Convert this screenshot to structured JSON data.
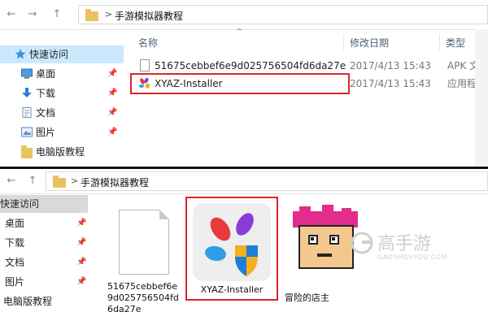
{
  "top_window": {
    "breadcrumb": {
      "sep": ">",
      "folder": "手游模拟器教程"
    },
    "nav": {
      "back": "←",
      "forward": "→",
      "up": "↑"
    },
    "columns": {
      "name": "名称",
      "date": "修改日期",
      "type": "类型"
    },
    "sidebar": [
      {
        "label": "快速访问",
        "icon": "star-icon"
      },
      {
        "label": "桌面",
        "icon": "desktop-icon",
        "pin": "📌"
      },
      {
        "label": "下载",
        "icon": "download-icon",
        "pin": "📌"
      },
      {
        "label": "文档",
        "icon": "document-icon",
        "pin": "📌"
      },
      {
        "label": "图片",
        "icon": "picture-icon",
        "pin": "📌"
      },
      {
        "label": "电脑版教程",
        "icon": "folder-icon"
      }
    ],
    "files": [
      {
        "name": "51675cebbef6e9d025756504fd6da27e",
        "date": "2017/4/13 15:43",
        "type": "APK 文件"
      },
      {
        "name": "XYAZ-Installer",
        "date": "2017/4/13 15:43",
        "type": "应用程序"
      }
    ]
  },
  "bottom_window": {
    "breadcrumb": {
      "sep": ">",
      "folder": "手游模拟器教程"
    },
    "sidebar": [
      {
        "label": "快速访问"
      },
      {
        "label": "桌面",
        "pin": "📌"
      },
      {
        "label": "下载",
        "pin": "📌"
      },
      {
        "label": "文档",
        "pin": "📌"
      },
      {
        "label": "图片",
        "pin": "📌"
      },
      {
        "label": "电脑版教程"
      }
    ],
    "icons": [
      {
        "label": "51675cebbef6e9d025756504fd6da27e"
      },
      {
        "label": "XYAZ-Installer"
      },
      {
        "label": "冒险的店主"
      }
    ]
  },
  "watermark": {
    "brand": "高手游",
    "site": "GAOSHOUYOU.COM"
  },
  "colors": {
    "highlight_red": "#d9262b",
    "selection_blue": "#cce8ff",
    "folder_yellow": "#e8c25d"
  }
}
